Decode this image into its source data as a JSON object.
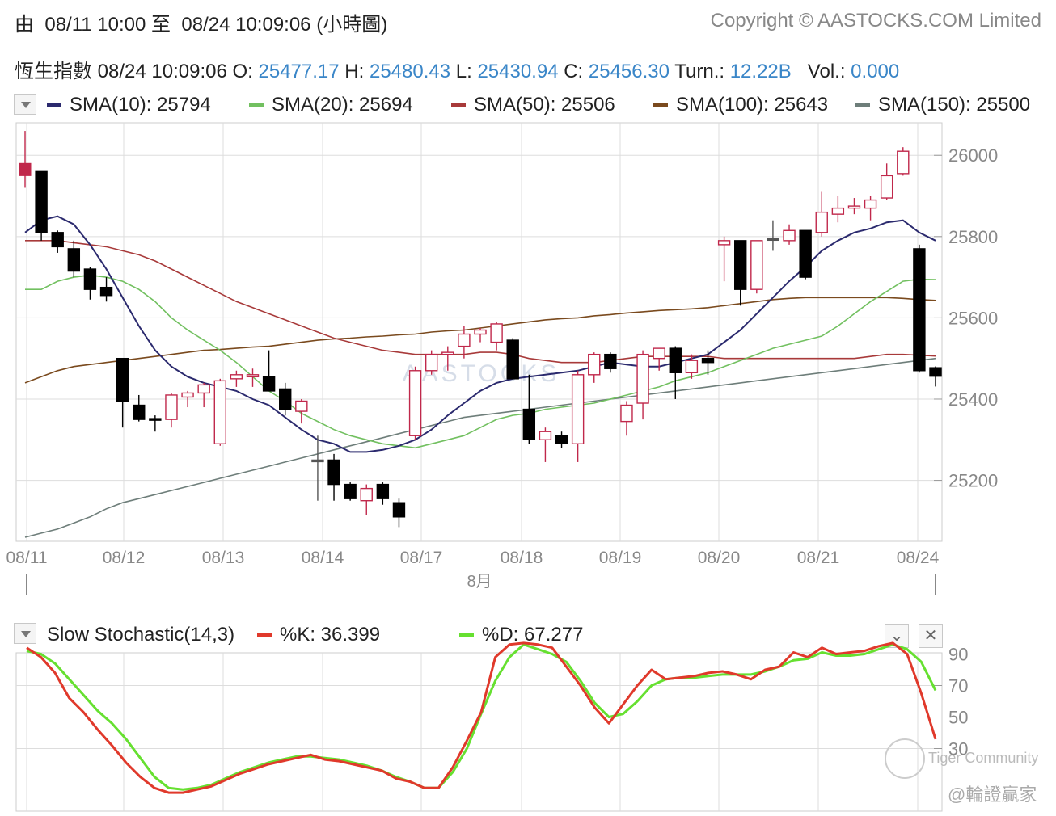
{
  "header": {
    "from_label": "由",
    "from_time": "08/11 10:00",
    "to_label": "至",
    "to_time": "08/24 10:09:06",
    "interval": "(小時圖)",
    "copyright": "Copyright © AASTOCKS.COM Limited"
  },
  "quote": {
    "name": "恆生指數",
    "time": "08/24 10:09:06",
    "o_label": "O:",
    "o": "25477.17",
    "h_label": "H:",
    "h": "25480.43",
    "l_label": "L:",
    "l": "25430.94",
    "c_label": "C:",
    "c": "25456.30",
    "turn_label": "Turn.:",
    "turn": "12.22B",
    "vol_label": "Vol.:",
    "vol": "0.000"
  },
  "colors": {
    "up": "#c0284b",
    "down": "#000000",
    "neutral": "#555555",
    "sma10": "#2b2a6e",
    "sma20": "#72c060",
    "sma50": "#a83a3a",
    "sma100": "#7a4a1e",
    "sma150": "#6e7e7a",
    "k": "#e0392b",
    "d": "#66e030",
    "grid": "#dddddd",
    "axis_text": "#888888"
  },
  "watermark": {
    "main": "AASTOCKS",
    "community": "Tiger Community",
    "handle": "@輪證贏家"
  },
  "chart_data": [
    {
      "type": "candlestick",
      "title": "",
      "legend_placement": "top",
      "ylim": [
        25050,
        26080
      ],
      "y_ticks": [
        26000,
        25800,
        25600,
        25400,
        25200
      ],
      "x_ticks": [
        "08/11",
        "08/12",
        "08/13",
        "08/14",
        "08/17",
        "08/18",
        "08/19",
        "08/20",
        "08/21",
        "08/24"
      ],
      "x_month_label": "8月",
      "grid": true,
      "sma_legend": [
        {
          "name": "SMA(10):",
          "value": "25794",
          "color_key": "sma10"
        },
        {
          "name": "SMA(20):",
          "value": "25694",
          "color_key": "sma20"
        },
        {
          "name": "SMA(50):",
          "value": "25506",
          "color_key": "sma50"
        },
        {
          "name": "SMA(100):",
          "value": "25643",
          "color_key": "sma100"
        },
        {
          "name": "SMA(150):",
          "value": "25500",
          "color_key": "sma150"
        }
      ],
      "candles": [
        {
          "o": 25950,
          "h": 26060,
          "l": 25920,
          "c": 25980
        },
        {
          "o": 25960,
          "h": 25960,
          "l": 25790,
          "c": 25810
        },
        {
          "o": 25810,
          "h": 25815,
          "l": 25760,
          "c": 25775
        },
        {
          "o": 25770,
          "h": 25790,
          "l": 25700,
          "c": 25715
        },
        {
          "o": 25720,
          "h": 25725,
          "l": 25645,
          "c": 25670
        },
        {
          "o": 25675,
          "h": 25700,
          "l": 25640,
          "c": 25655
        },
        {
          "o": 25500,
          "h": 25500,
          "l": 25330,
          "c": 25395
        },
        {
          "o": 25385,
          "h": 25410,
          "l": 25345,
          "c": 25350
        },
        {
          "o": 25352,
          "h": 25360,
          "l": 25320,
          "c": 25348
        },
        {
          "o": 25350,
          "h": 25415,
          "l": 25330,
          "c": 25410
        },
        {
          "o": 25405,
          "h": 25420,
          "l": 25380,
          "c": 25415
        },
        {
          "o": 25415,
          "h": 25440,
          "l": 25380,
          "c": 25435
        },
        {
          "o": 25290,
          "h": 25450,
          "l": 25285,
          "c": 25445
        },
        {
          "o": 25450,
          "h": 25470,
          "l": 25430,
          "c": 25460
        },
        {
          "o": 25455,
          "h": 25475,
          "l": 25430,
          "c": 25460
        },
        {
          "o": 25455,
          "h": 25520,
          "l": 25420,
          "c": 25420
        },
        {
          "o": 25425,
          "h": 25440,
          "l": 25360,
          "c": 25375
        },
        {
          "o": 25370,
          "h": 25400,
          "l": 25340,
          "c": 25395
        },
        {
          "o": 25250,
          "h": 25310,
          "l": 25150,
          "c": 25250
        },
        {
          "o": 25250,
          "h": 25265,
          "l": 25150,
          "c": 25190
        },
        {
          "o": 25190,
          "h": 25195,
          "l": 25150,
          "c": 25155
        },
        {
          "o": 25150,
          "h": 25190,
          "l": 25115,
          "c": 25180
        },
        {
          "o": 25190,
          "h": 25195,
          "l": 25140,
          "c": 25155
        },
        {
          "o": 25145,
          "h": 25155,
          "l": 25085,
          "c": 25110
        },
        {
          "o": 25310,
          "h": 25480,
          "l": 25300,
          "c": 25470
        },
        {
          "o": 25470,
          "h": 25520,
          "l": 25460,
          "c": 25510
        },
        {
          "o": 25510,
          "h": 25530,
          "l": 25470,
          "c": 25515
        },
        {
          "o": 25530,
          "h": 25580,
          "l": 25500,
          "c": 25560
        },
        {
          "o": 25560,
          "h": 25575,
          "l": 25540,
          "c": 25570
        },
        {
          "o": 25540,
          "h": 25590,
          "l": 25520,
          "c": 25585
        },
        {
          "o": 25545,
          "h": 25550,
          "l": 25450,
          "c": 25450
        },
        {
          "o": 25375,
          "h": 25460,
          "l": 25290,
          "c": 25300
        },
        {
          "o": 25300,
          "h": 25330,
          "l": 25245,
          "c": 25320
        },
        {
          "o": 25310,
          "h": 25320,
          "l": 25280,
          "c": 25290
        },
        {
          "o": 25290,
          "h": 25470,
          "l": 25245,
          "c": 25460
        },
        {
          "o": 25460,
          "h": 25515,
          "l": 25440,
          "c": 25510
        },
        {
          "o": 25510,
          "h": 25515,
          "l": 25465,
          "c": 25475
        },
        {
          "o": 25345,
          "h": 25395,
          "l": 25310,
          "c": 25385
        },
        {
          "o": 25390,
          "h": 25520,
          "l": 25350,
          "c": 25510
        },
        {
          "o": 25500,
          "h": 25525,
          "l": 25470,
          "c": 25525
        },
        {
          "o": 25525,
          "h": 25530,
          "l": 25400,
          "c": 25465
        },
        {
          "o": 25465,
          "h": 25510,
          "l": 25450,
          "c": 25495
        },
        {
          "o": 25500,
          "h": 25520,
          "l": 25460,
          "c": 25490
        },
        {
          "o": 25780,
          "h": 25800,
          "l": 25690,
          "c": 25790
        },
        {
          "o": 25790,
          "h": 25790,
          "l": 25630,
          "c": 25670
        },
        {
          "o": 25670,
          "h": 25790,
          "l": 25660,
          "c": 25790
        },
        {
          "o": 25795,
          "h": 25840,
          "l": 25765,
          "c": 25795
        },
        {
          "o": 25790,
          "h": 25830,
          "l": 25780,
          "c": 25815
        },
        {
          "o": 25815,
          "h": 25815,
          "l": 25695,
          "c": 25700
        },
        {
          "o": 25810,
          "h": 25910,
          "l": 25800,
          "c": 25860
        },
        {
          "o": 25855,
          "h": 25900,
          "l": 25835,
          "c": 25870
        },
        {
          "o": 25870,
          "h": 25895,
          "l": 25855,
          "c": 25875
        },
        {
          "o": 25870,
          "h": 25900,
          "l": 25840,
          "c": 25890
        },
        {
          "o": 25895,
          "h": 25980,
          "l": 25890,
          "c": 25950
        },
        {
          "o": 25955,
          "h": 26020,
          "l": 25950,
          "c": 26010
        },
        {
          "o": 25770,
          "h": 25780,
          "l": 25465,
          "c": 25470
        },
        {
          "o": 25477.17,
          "h": 25480.43,
          "l": 25430.94,
          "c": 25456.3
        }
      ],
      "sma_series": {
        "sma10": [
          25810,
          25840,
          25850,
          25830,
          25780,
          25720,
          25650,
          25580,
          25520,
          25480,
          25455,
          25440,
          25430,
          25420,
          25400,
          25385,
          25355,
          25325,
          25300,
          25290,
          25270,
          25270,
          25275,
          25285,
          25300,
          25325,
          25360,
          25390,
          25420,
          25440,
          25450,
          25455,
          25460,
          25465,
          25470,
          25480,
          25490,
          25485,
          25480,
          25480,
          25490,
          25500,
          25510,
          25540,
          25570,
          25610,
          25650,
          25690,
          25725,
          25765,
          25790,
          25810,
          25820,
          25835,
          25840,
          25810,
          25790
        ],
        "sma20": [
          25670,
          25670,
          25690,
          25700,
          25705,
          25700,
          25690,
          25670,
          25640,
          25600,
          25570,
          25545,
          25520,
          25490,
          25455,
          25420,
          25395,
          25365,
          25345,
          25325,
          25310,
          25300,
          25290,
          25285,
          25280,
          25290,
          25300,
          25310,
          25330,
          25350,
          25360,
          25365,
          25375,
          25380,
          25385,
          25390,
          25400,
          25410,
          25420,
          25430,
          25445,
          25455,
          25465,
          25480,
          25495,
          25510,
          25525,
          25535,
          25545,
          25555,
          25580,
          25610,
          25640,
          25665,
          25690,
          25695,
          25694
        ],
        "sma50": [
          25790,
          25790,
          25790,
          25785,
          25780,
          25775,
          25765,
          25755,
          25740,
          25720,
          25700,
          25680,
          25660,
          25640,
          25625,
          25610,
          25595,
          25580,
          25565,
          25550,
          25540,
          25530,
          25520,
          25515,
          25510,
          25510,
          25510,
          25510,
          25515,
          25515,
          25510,
          25500,
          25495,
          25490,
          25490,
          25490,
          25495,
          25500,
          25505,
          25505,
          25505,
          25505,
          25505,
          25500,
          25500,
          25500,
          25500,
          25500,
          25500,
          25500,
          25500,
          25500,
          25505,
          25510,
          25510,
          25508,
          25506
        ],
        "sma100": [
          25440,
          25455,
          25470,
          25480,
          25485,
          25490,
          25495,
          25500,
          25505,
          25510,
          25515,
          25520,
          25522,
          25525,
          25528,
          25530,
          25535,
          25540,
          25545,
          25548,
          25550,
          25553,
          25555,
          25558,
          25560,
          25565,
          25568,
          25570,
          25575,
          25580,
          25585,
          25590,
          25595,
          25598,
          25600,
          25605,
          25608,
          25612,
          25615,
          25618,
          25620,
          25622,
          25625,
          25630,
          25635,
          25640,
          25645,
          25648,
          25650,
          25650,
          25650,
          25650,
          25650,
          25650,
          25648,
          25645,
          25643
        ],
        "sma150": [
          25060,
          25070,
          25080,
          25095,
          25110,
          25130,
          25145,
          25155,
          25165,
          25175,
          25185,
          25195,
          25205,
          25215,
          25225,
          25235,
          25245,
          25255,
          25265,
          25275,
          25285,
          25295,
          25305,
          25315,
          25325,
          25335,
          25345,
          25355,
          25360,
          25365,
          25370,
          25375,
          25380,
          25385,
          25390,
          25395,
          25400,
          25405,
          25410,
          25415,
          25420,
          25425,
          25430,
          25435,
          25440,
          25445,
          25450,
          25455,
          25460,
          25465,
          25470,
          25475,
          25480,
          25485,
          25490,
          25495,
          25500
        ]
      }
    },
    {
      "type": "line",
      "title": "Slow Stochastic(14,3)",
      "legend_placement": "top",
      "ylim": [
        0,
        100
      ],
      "y_ticks": [
        90,
        70,
        50,
        30
      ],
      "grid": true,
      "series": [
        {
          "name": "%K:",
          "value": "36.399",
          "color_key": "k",
          "values": [
            94,
            88,
            78,
            62,
            53,
            42,
            32,
            21,
            12,
            5,
            2,
            2,
            4,
            6,
            10,
            14,
            17,
            20,
            22,
            24,
            26,
            23,
            22,
            20,
            18,
            16,
            11,
            9,
            5,
            5,
            18,
            35,
            53,
            88,
            96,
            97,
            96,
            94,
            82,
            70,
            56,
            46,
            58,
            70,
            80,
            74,
            75,
            76,
            78,
            79,
            77,
            74,
            80,
            82,
            91,
            88,
            94,
            90,
            91,
            92,
            95,
            97,
            90,
            65,
            36
          ]
        },
        {
          "name": "%D:",
          "value": "67.277",
          "color_key": "d",
          "values": [
            92,
            90,
            84,
            74,
            64,
            54,
            46,
            36,
            24,
            12,
            5,
            4,
            5,
            7,
            11,
            15,
            18,
            21,
            23,
            25,
            25,
            24,
            23,
            21,
            19,
            16,
            12,
            9,
            5,
            5,
            15,
            30,
            52,
            73,
            88,
            96,
            93,
            90,
            85,
            73,
            59,
            50,
            52,
            60,
            70,
            74,
            75,
            75,
            76,
            77,
            77,
            77,
            79,
            82,
            86,
            87,
            91,
            89,
            89,
            90,
            93,
            96,
            93,
            85,
            67
          ]
        }
      ]
    }
  ]
}
